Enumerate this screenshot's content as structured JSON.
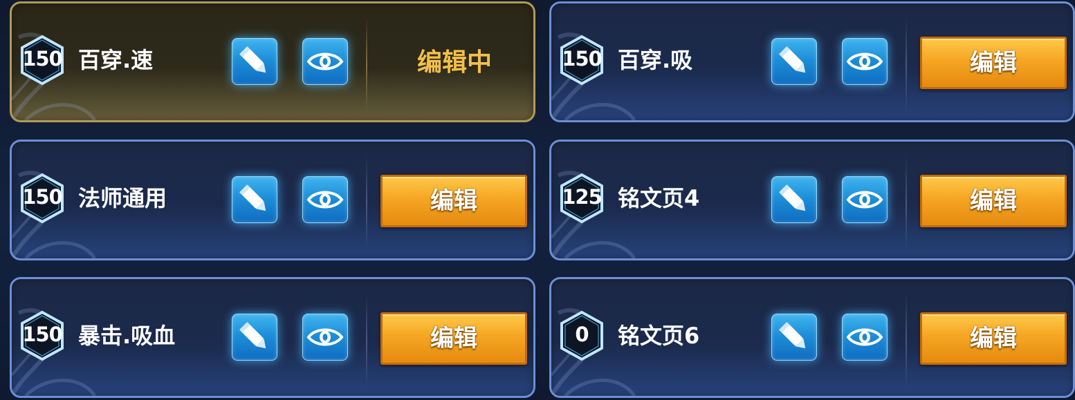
{
  "cards": [
    {
      "level": "150",
      "name": "百穿.速",
      "action": "编辑中",
      "active": true
    },
    {
      "level": "150",
      "name": "百穿.吸",
      "action": "编辑",
      "active": false
    },
    {
      "level": "150",
      "name": "法师通用",
      "action": "编辑",
      "active": false
    },
    {
      "level": "125",
      "name": "铭文页4",
      "action": "编辑",
      "active": false
    },
    {
      "level": "150",
      "name": "暴击.吸血",
      "action": "编辑",
      "active": false
    },
    {
      "level": "0",
      "name": "铭文页6",
      "action": "编辑",
      "active": false
    }
  ],
  "icons": {
    "level_badge": "hexagon-badge-icon",
    "rename": "pencil-icon",
    "preview": "eye-icon"
  },
  "colors": {
    "card_border": "#6c8fd6",
    "active_border": "#b39a55",
    "edit_button": "#f5a623",
    "editing_text": "#f3c04a",
    "icon_button": "#1e8fd8"
  }
}
